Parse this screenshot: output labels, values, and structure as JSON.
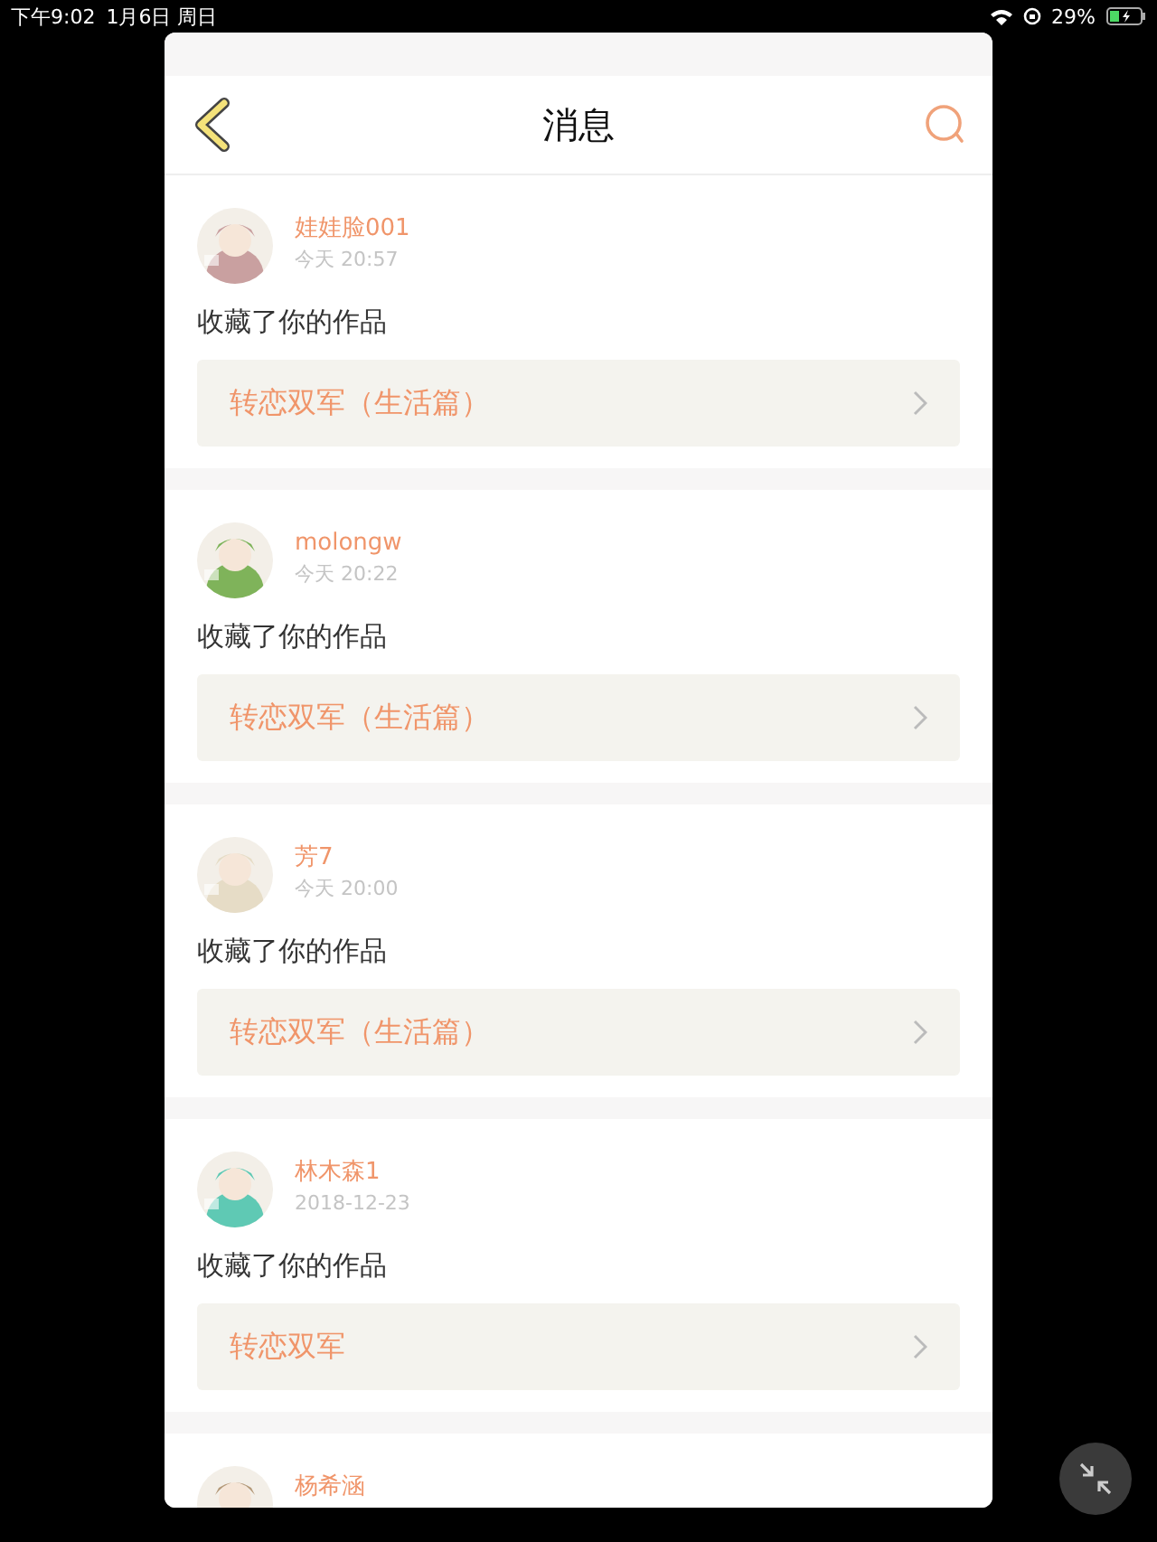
{
  "status_bar": {
    "time": "下午9:02",
    "date": "1月6日 周日",
    "battery": "29%"
  },
  "header": {
    "title": "消息"
  },
  "messages": [
    {
      "name": "娃娃脸001",
      "time": "今天 20:57",
      "action": "收藏了你的作品",
      "work": "转恋双军（生活篇）"
    },
    {
      "name": "molongw",
      "time": "今天 20:22",
      "action": "收藏了你的作品",
      "work": "转恋双军（生活篇）"
    },
    {
      "name": "芳7",
      "time": "今天 20:00",
      "action": "收藏了你的作品",
      "work": "转恋双军（生活篇）"
    },
    {
      "name": "林木森1",
      "time": "2018-12-23",
      "action": "收藏了你的作品",
      "work": "转恋双军"
    },
    {
      "name": "杨希涵"
    }
  ]
}
